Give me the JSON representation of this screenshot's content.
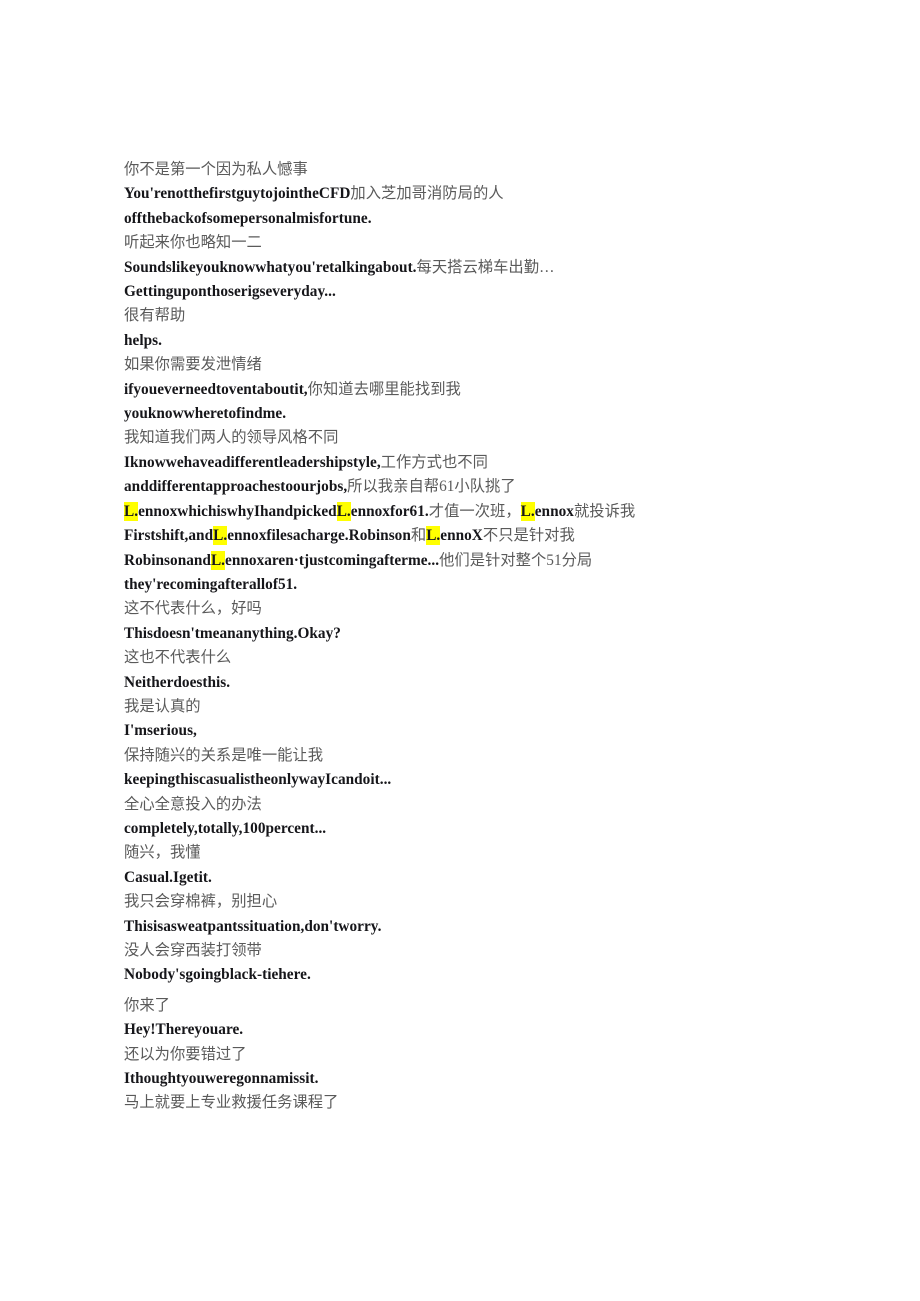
{
  "document": {
    "type": "bilingual-subtitle-transcript",
    "background_color": "#ffffff",
    "translation_color": "#5a5a5a",
    "original_color": "#16161a",
    "highlight_color": "#ffff00",
    "highlight_token": "L."
  },
  "lines": [
    {
      "id": "l01",
      "lang": "zh",
      "text": "你不是第一个因为私人憾事"
    },
    {
      "id": "l02",
      "lang": "mixed",
      "en_a": "You'renotthefirstguytojointheCFD",
      "zh_b": "加入芝加哥消防局的人"
    },
    {
      "id": "l03",
      "lang": "en",
      "text": "offthebackofsomepersonalmisfortune."
    },
    {
      "id": "l04",
      "lang": "zh",
      "text": "听起来你也略知一二"
    },
    {
      "id": "l05",
      "lang": "mixed",
      "en_a": "Soundslikeyouknowwhatyou'retalkingabout.",
      "zh_b": "每天搭云梯车出勤…"
    },
    {
      "id": "l06",
      "lang": "en",
      "text": "Gettinguponthoserigseveryday..."
    },
    {
      "id": "l07",
      "lang": "zh",
      "text": "很有帮助"
    },
    {
      "id": "l08",
      "lang": "en",
      "text": "helps."
    },
    {
      "id": "l09",
      "lang": "zh",
      "text": "如果你需要发泄情绪"
    },
    {
      "id": "l10",
      "lang": "mixed",
      "en_a": "ifyoueverneedtoventaboutit,",
      "zh_b": "你知道去哪里能找到我"
    },
    {
      "id": "l11",
      "lang": "en",
      "text": "youknowwheretofindme."
    },
    {
      "id": "l12",
      "lang": "zh",
      "text": "我知道我们两人的领导风格不同"
    },
    {
      "id": "l13",
      "lang": "mixed",
      "en_a": "Iknowwehaveadifferentleadershipstyle,",
      "zh_b": "工作方式也不同"
    },
    {
      "id": "l14",
      "lang": "mixed",
      "en_a": "anddifferentapproachestoourjobs,",
      "zh_b": "所以我亲自帮61小队挑了"
    },
    {
      "id": "l15",
      "lang": "highlight-a",
      "seg": [
        {
          "hl": "L."
        },
        {
          "en": "ennoxwhichiswhyIhandpicked"
        },
        {
          "hl": "L."
        },
        {
          "en": "ennoxfor61."
        },
        {
          "zh": "才值一次班，"
        },
        {
          "hl": "L."
        },
        {
          "en": "ennox"
        },
        {
          "zh": "就投诉我"
        }
      ]
    },
    {
      "id": "l16",
      "lang": "highlight-b",
      "seg": [
        {
          "en": "Firstshift,and"
        },
        {
          "hl": "L."
        },
        {
          "en": "ennoxfilesacharge.Robinson"
        },
        {
          "zh": "和"
        },
        {
          "hl": "L."
        },
        {
          "en": "ennoX"
        },
        {
          "zh": "不只是针对我"
        }
      ]
    },
    {
      "id": "l17",
      "lang": "highlight-c",
      "seg": [
        {
          "en": "Robinsonand"
        },
        {
          "hl": "L."
        },
        {
          "en": "ennoxaren·tjustcomingafterme..."
        },
        {
          "zh": "他们是针对整个51分局"
        }
      ]
    },
    {
      "id": "l18",
      "lang": "en",
      "text": "they'recomingafterallof51."
    },
    {
      "id": "l19",
      "lang": "zh",
      "text": "这不代表什么，好吗"
    },
    {
      "id": "l20",
      "lang": "en",
      "text": "Thisdoesn'tmeananything.Okay?"
    },
    {
      "id": "l21",
      "lang": "zh",
      "text": "这也不代表什么"
    },
    {
      "id": "l22",
      "lang": "en",
      "text": "Neitherdoesthis."
    },
    {
      "id": "l23",
      "lang": "zh",
      "text": "我是认真的"
    },
    {
      "id": "l24",
      "lang": "en",
      "text": "I'mserious,"
    },
    {
      "id": "l25",
      "lang": "zh",
      "text": "保持随兴的关系是唯一能让我"
    },
    {
      "id": "l26",
      "lang": "en",
      "text": "keepingthiscasualistheonlywayIcandoit..."
    },
    {
      "id": "l27",
      "lang": "zh",
      "text": "全心全意投入的办法"
    },
    {
      "id": "l28",
      "lang": "en",
      "text": "completely,totally,100percent..."
    },
    {
      "id": "l29",
      "lang": "zh",
      "text": "随兴，我懂"
    },
    {
      "id": "l30",
      "lang": "en",
      "text": "Casual.Igetit."
    },
    {
      "id": "l31",
      "lang": "zh",
      "text": "我只会穿棉裤，别担心"
    },
    {
      "id": "l32",
      "lang": "en",
      "text": "Thisisasweatpantssituation,don'tworry."
    },
    {
      "id": "l33",
      "lang": "zh",
      "text": "没人会穿西装打领带"
    },
    {
      "id": "l34",
      "lang": "en",
      "text": "Nobody'sgoingblack-tiehere."
    },
    {
      "id": "l35",
      "lang": "zh",
      "text": "你来了",
      "gap_before": true
    },
    {
      "id": "l36",
      "lang": "en",
      "text": "Hey!Thereyouare."
    },
    {
      "id": "l37",
      "lang": "zh",
      "text": "还以为你要错过了"
    },
    {
      "id": "l38",
      "lang": "en",
      "text": "Ithoughtyouweregonnamissit."
    },
    {
      "id": "l39",
      "lang": "zh",
      "text": "马上就要上专业救援任务课程了"
    }
  ]
}
